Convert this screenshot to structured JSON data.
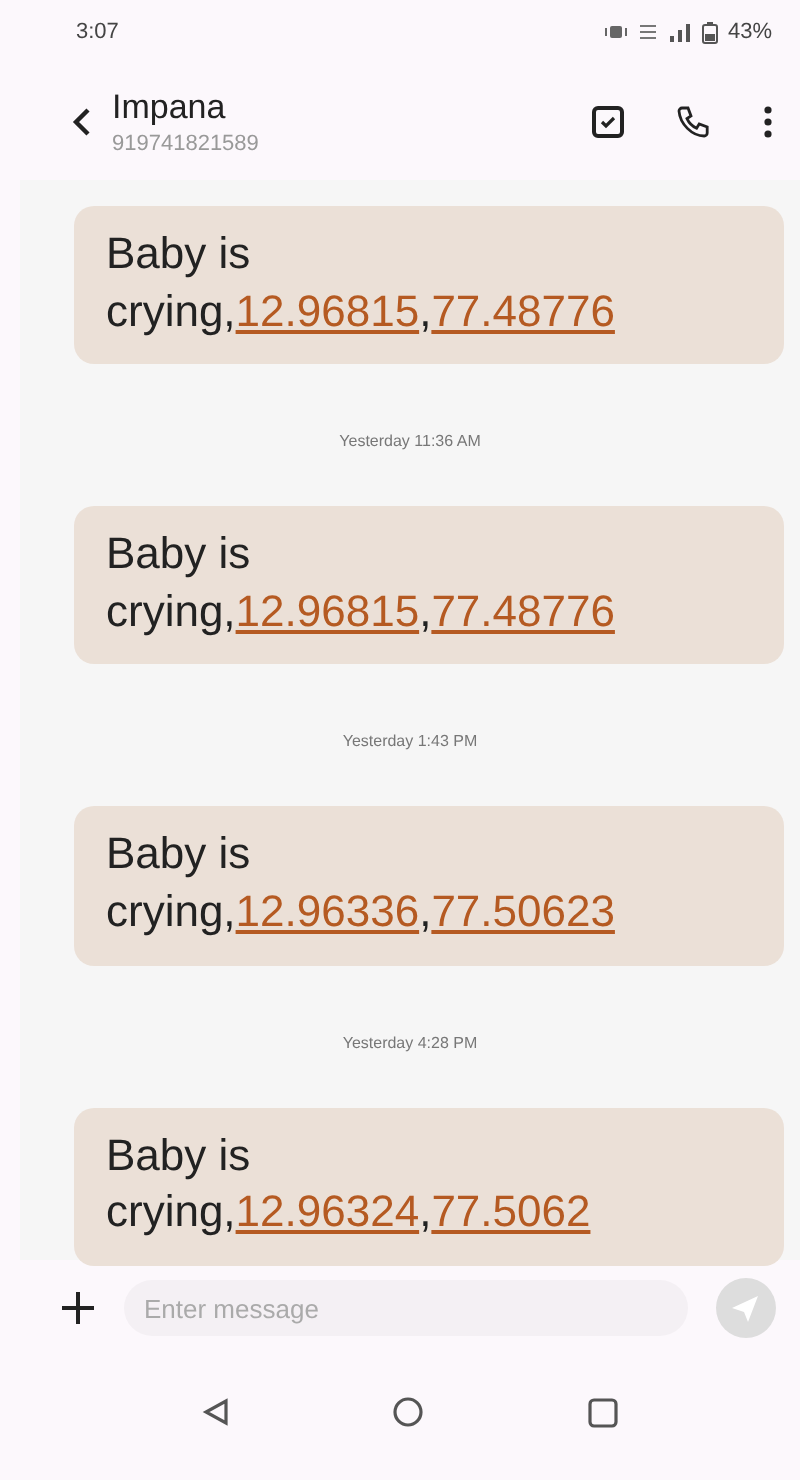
{
  "status_bar": {
    "time": "3:07",
    "battery": "43%"
  },
  "header": {
    "name": "Impana",
    "number": "919741821589"
  },
  "messages": [
    {
      "parts": [
        {
          "kind": "text",
          "text": "Baby is crying,"
        },
        {
          "kind": "link",
          "text": "12.96815"
        },
        {
          "kind": "text",
          "text": ","
        },
        {
          "kind": "link",
          "text": "77.48776"
        }
      ]
    },
    {
      "timestamp": "Yesterday 11:36 AM",
      "parts": [
        {
          "kind": "text",
          "text": "Baby is crying,"
        },
        {
          "kind": "link",
          "text": "12.96815"
        },
        {
          "kind": "text",
          "text": ","
        },
        {
          "kind": "link",
          "text": "77.48776"
        }
      ]
    },
    {
      "timestamp": "Yesterday 1:43 PM",
      "parts": [
        {
          "kind": "text",
          "text": "Baby is crying,"
        },
        {
          "kind": "link",
          "text": "12.96336"
        },
        {
          "kind": "text",
          "text": ","
        },
        {
          "kind": "link",
          "text": "77.50623"
        }
      ]
    },
    {
      "timestamp": "Yesterday 4:28 PM",
      "parts": [
        {
          "kind": "text",
          "text": "Baby is crying,"
        },
        {
          "kind": "link",
          "text": "12.96324"
        },
        {
          "kind": "text",
          "text": ","
        },
        {
          "kind": "link",
          "text": "77.5062"
        }
      ]
    }
  ],
  "composer": {
    "placeholder": "Enter message"
  }
}
